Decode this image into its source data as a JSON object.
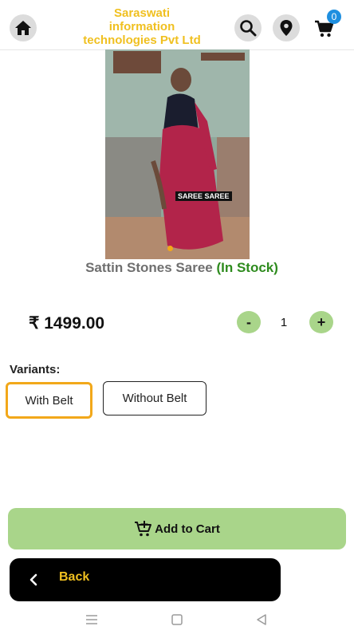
{
  "header": {
    "brand_line1": "Saraswati",
    "brand_line2": "information",
    "brand_line3": "technologies Pvt Ltd",
    "cart_count": "0",
    "icons": [
      "home-icon",
      "search-icon",
      "location-pin-icon",
      "cart-icon"
    ]
  },
  "product": {
    "image_caption": "SAREE SAREE",
    "name": "Sattin Stones Saree",
    "stock_status": "(In Stock)",
    "price": "₹ 1499.00",
    "quantity": "1",
    "qty_minus_label": "-",
    "qty_plus_label": "+"
  },
  "variants": {
    "label": "Variants:",
    "options": [
      "With Belt",
      "Without Belt"
    ],
    "selected": "With Belt"
  },
  "actions": {
    "add_to_cart_label": "Add to Cart",
    "back_label": "Back"
  },
  "colors": {
    "accent_green": "#a9d58a",
    "brand_yellow": "#f0c020",
    "in_stock_green": "#2e8b1e",
    "selected_border": "#f2a81a",
    "badge_blue": "#1e8fe0"
  }
}
